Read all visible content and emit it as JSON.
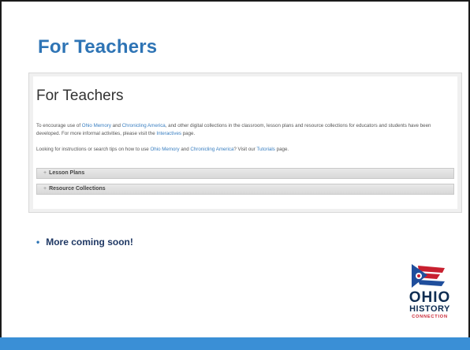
{
  "slide": {
    "title": "For Teachers"
  },
  "screenshot": {
    "heading": "For Teachers",
    "p1": {
      "t1": "To encourage use of ",
      "link1": "Ohio Memory",
      "t2": " and ",
      "link2": "Chronicling America",
      "t3": ", and other digital collections in the classroom, lesson plans and resource collections for educators and students have been developed. For more informal activities, please visit the ",
      "link3": "Interactives",
      "t4": " page."
    },
    "p2": {
      "t1": "Looking for instructions or search tips on how to use ",
      "link1": "Ohio Memory",
      "t2": " and ",
      "link2": "Chronicling America",
      "t3": "? Visit our ",
      "link3": "Tutorials",
      "t4": " page."
    },
    "accordion": [
      {
        "icon": "+",
        "label": "Lesson Plans"
      },
      {
        "icon": "+",
        "label": "Resource Collections"
      }
    ]
  },
  "bullets": [
    {
      "text": "More coming soon!"
    }
  ],
  "logo": {
    "line1": "OHIO",
    "line2": "HISTORY",
    "line3": "CONNECTION"
  },
  "colors": {
    "title": "#2e74b5",
    "link": "#3a7fc1",
    "bar": "#3a8fd6",
    "logo_navy": "#0f2d52",
    "logo_red": "#c8202f"
  }
}
